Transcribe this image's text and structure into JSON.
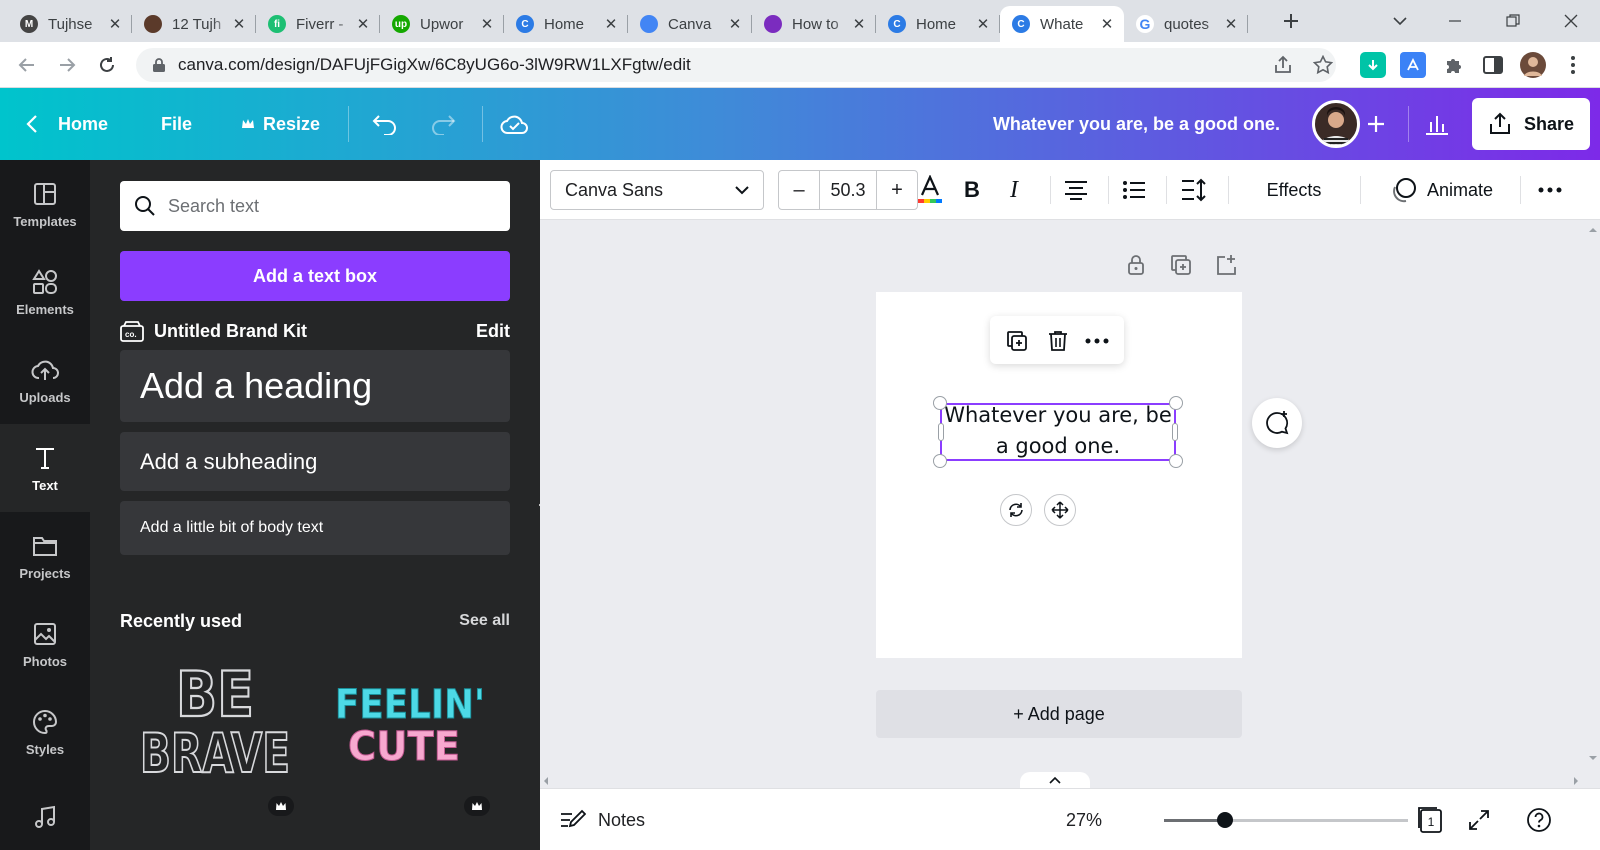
{
  "browser": {
    "tabs": [
      {
        "title": "Tujhse",
        "favicon_color": "#444444",
        "favicon_text": "M"
      },
      {
        "title": "12 Tujh",
        "favicon_color": "#5b3a2a",
        "favicon_text": ""
      },
      {
        "title": "Fiverr -",
        "favicon_color": "#1dbf73",
        "favicon_text": "fi"
      },
      {
        "title": "Upwor",
        "favicon_color": "#14a800",
        "favicon_text": "up"
      },
      {
        "title": "Home",
        "favicon_color": "#2c7be5",
        "favicon_text": "C"
      },
      {
        "title": "Canva",
        "favicon_color": "#4285f4",
        "favicon_text": ""
      },
      {
        "title": "How to",
        "favicon_color": "#7b2cbf",
        "favicon_text": ""
      },
      {
        "title": "Home",
        "favicon_color": "#2c7be5",
        "favicon_text": "C"
      },
      {
        "title": "Whate",
        "favicon_color": "#2c7be5",
        "favicon_text": "C"
      },
      {
        "title": "quotes",
        "favicon_color": "#ffffff",
        "favicon_text": "G"
      }
    ],
    "active_tab_index": 8,
    "url": "canva.com/design/DAFUjFGigXw/6C8yUG6o-3lW9RW1LXFgtw/edit"
  },
  "header": {
    "home_label": "Home",
    "file_label": "File",
    "resize_label": "Resize",
    "doc_title": "Whatever you are, be a good one.",
    "share_label": "Share"
  },
  "rail": {
    "items": [
      {
        "label": "Templates",
        "icon": "templates-icon"
      },
      {
        "label": "Elements",
        "icon": "elements-icon"
      },
      {
        "label": "Uploads",
        "icon": "uploads-icon"
      },
      {
        "label": "Text",
        "icon": "text-icon"
      },
      {
        "label": "Projects",
        "icon": "projects-icon"
      },
      {
        "label": "Photos",
        "icon": "photos-icon"
      },
      {
        "label": "Styles",
        "icon": "styles-icon"
      },
      {
        "label": "",
        "icon": "audio-icon"
      }
    ],
    "active_label": "Text"
  },
  "panel": {
    "search_placeholder": "Search text",
    "add_textbox_label": "Add a text box",
    "brand_kit_label": "Untitled Brand Kit",
    "edit_label": "Edit",
    "heading_label": "Add a heading",
    "subheading_label": "Add a subheading",
    "body_label": "Add a little bit of body text",
    "recently_used_label": "Recently used",
    "see_all_label": "See all",
    "thumb1": {
      "line1": "BE",
      "line2": "BRAVE"
    },
    "thumb2": {
      "line1": "FEELIN'",
      "line2": "CUTE"
    }
  },
  "context_toolbar": {
    "font_name": "Canva Sans",
    "font_size": "50.3",
    "decrease_label": "–",
    "increase_label": "+",
    "bold_label": "B",
    "italic_label": "I",
    "effects_label": "Effects",
    "animate_label": "Animate"
  },
  "canvas": {
    "text": "Whatever you are, be a good one.",
    "add_page_label": "+ Add page"
  },
  "footer": {
    "notes_label": "Notes",
    "zoom_label": "27%",
    "zoom_fraction": 0.25,
    "page_count": "1"
  },
  "colors": {
    "accent": "#8b3dff",
    "header_start": "#00c4cc",
    "header_end": "#7d2ae8"
  }
}
